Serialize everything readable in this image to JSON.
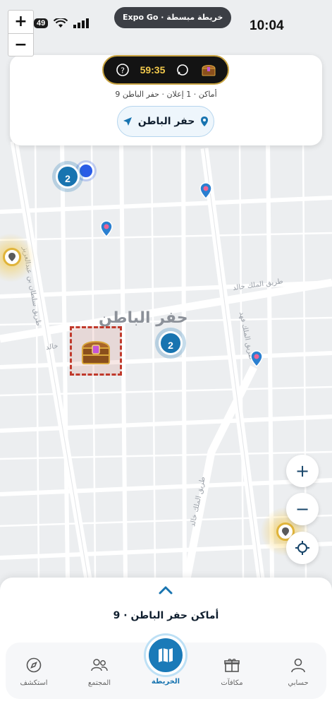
{
  "status_bar": {
    "time": "10:04",
    "battery": "49",
    "expo_pill": "Expo Go · خريطة مبسطة"
  },
  "map_zoom": {
    "plus": "+",
    "minus": "−"
  },
  "top_card": {
    "timer": "59:35",
    "summary": "9 أماكن · 1 إعلان · حفر الباطن",
    "location_button": "حفر الباطن"
  },
  "map": {
    "district_label": "حفر الباطن",
    "streets": [
      "طريق الملك خالد",
      "طريق الملك فهد",
      "طريق سلطان بن عبدالعزيز",
      "طريق الملك خالد",
      "خالد"
    ],
    "clusters": [
      "2",
      "2"
    ]
  },
  "map_controls": {
    "zoom_in": "+",
    "zoom_out": "−"
  },
  "sheet": {
    "title": "أماكن حفر الباطن · 9"
  },
  "tabs": [
    {
      "label": "حسابي",
      "icon": "user-icon"
    },
    {
      "label": "مكافآت",
      "icon": "gift-icon"
    },
    {
      "label": "الخريطة",
      "icon": "map-icon"
    },
    {
      "label": "المجتمع",
      "icon": "community-icon"
    },
    {
      "label": "استكشف",
      "icon": "compass-icon"
    }
  ],
  "colors": {
    "accent": "#1874b0",
    "gold": "#c9a441",
    "timer": "#f2c94c",
    "pin": "#2a7fd0"
  }
}
